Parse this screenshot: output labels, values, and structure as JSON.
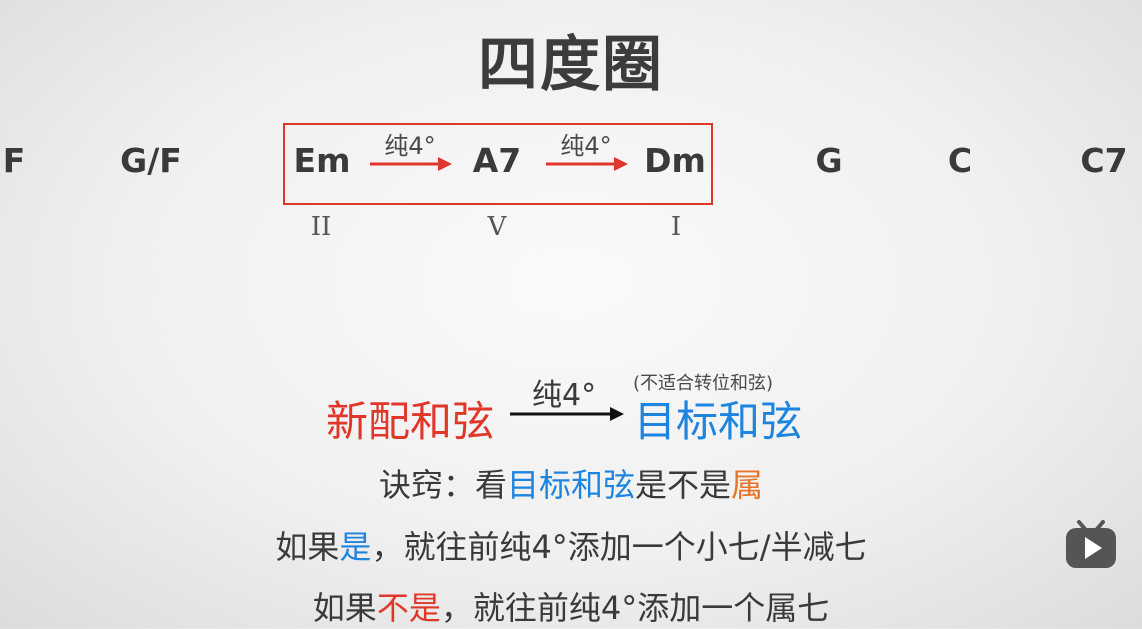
{
  "title": "四度圈",
  "chords": {
    "f": "F",
    "gf": "G/F",
    "em": "Em",
    "a7": "A7",
    "dm": "Dm",
    "g": "G",
    "c": "C",
    "c7": "C7"
  },
  "intervals": {
    "first": "纯4°",
    "second": "纯4°"
  },
  "roman": {
    "ii": "II",
    "v": "V",
    "i": "I"
  },
  "rule": {
    "new_chord": "新配和弦",
    "interval": "纯4°",
    "note": "(不适合转位和弦)",
    "target_chord": "目标和弦"
  },
  "tip": {
    "prefix": "诀窍：看",
    "target": "目标和弦",
    "middle": "是不是",
    "dominant": "属"
  },
  "if_yes": {
    "prefix": "如果",
    "yes": "是",
    "rest": "，就往前纯4°添加一个小七/半减七"
  },
  "if_no": {
    "prefix": "如果",
    "no": "不是",
    "rest": "，就往前纯4°添加一个属七"
  },
  "colors": {
    "red": "#e0372a",
    "blue": "#1d84e0",
    "orange": "#e8742a",
    "text": "#3a3a3a"
  },
  "icons": {
    "play": "bilibili-play-icon"
  }
}
